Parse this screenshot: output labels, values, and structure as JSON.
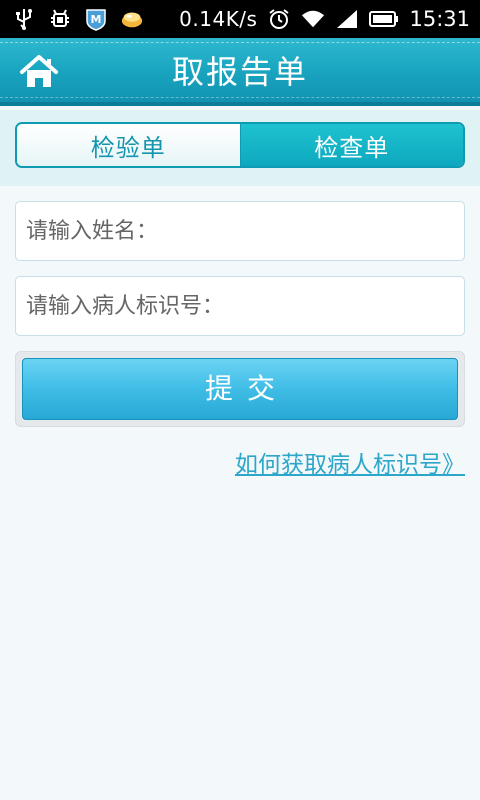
{
  "statusbar": {
    "net_speed": "0.14K/s",
    "time": "15:31",
    "icons": [
      "usb-icon",
      "android-debug-icon",
      "app-notification-icon",
      "food-app-icon",
      "alarm-icon",
      "wifi-icon",
      "signal-icon",
      "battery-icon"
    ]
  },
  "header": {
    "title": "取报告单",
    "home_icon": "home-icon"
  },
  "tabs": {
    "items": [
      {
        "label": "检验单",
        "selected": false
      },
      {
        "label": "检查单",
        "selected": true
      }
    ]
  },
  "form": {
    "name_placeholder": "请输入姓名：",
    "id_placeholder": "请输入病人标识号：",
    "submit_label": "提交"
  },
  "help": {
    "link_text": "如何获取病人标识号》"
  },
  "colors": {
    "accent": "#18a3bf",
    "button": "#3fbde6",
    "link": "#2ca6c9"
  }
}
